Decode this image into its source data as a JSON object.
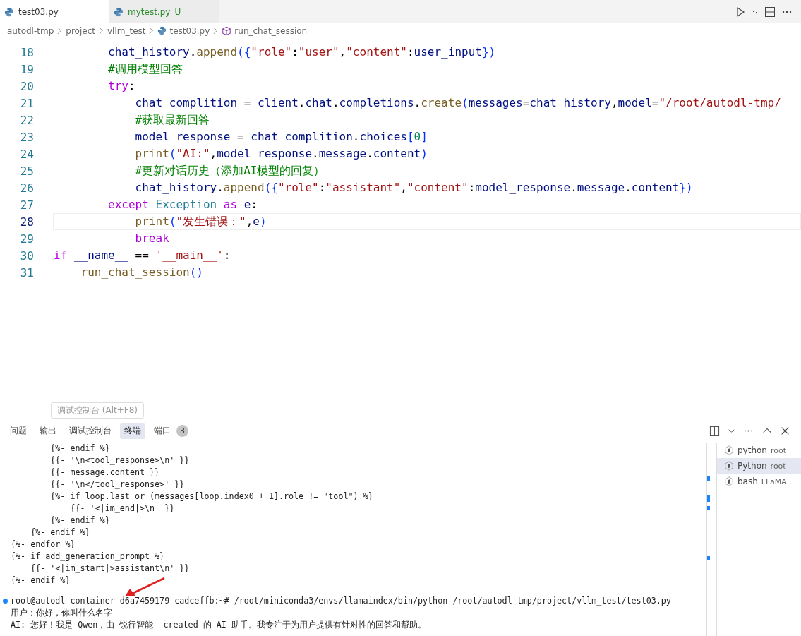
{
  "tabs": [
    {
      "label": "test03.py",
      "selected": true
    },
    {
      "label": "mytest.py",
      "selected": false,
      "status": "U"
    }
  ],
  "breadcrumb": [
    {
      "label": "autodl-tmp",
      "kind": "folder"
    },
    {
      "label": "project",
      "kind": "folder"
    },
    {
      "label": "vllm_test",
      "kind": "folder"
    },
    {
      "label": "test03.py",
      "kind": "file"
    },
    {
      "label": "run_chat_session",
      "kind": "symbol"
    }
  ],
  "editor": {
    "lines": [
      {
        "number": "18",
        "selected": false,
        "tokens": [
          {
            "kind": "variable",
            "text": "        chat_history"
          },
          {
            "kind": "plain",
            "text": "."
          },
          {
            "kind": "function",
            "text": "append"
          },
          {
            "kind": "bracket",
            "text": "({"
          },
          {
            "kind": "string",
            "text": "\"role\""
          },
          {
            "kind": "plain",
            "text": ":"
          },
          {
            "kind": "string",
            "text": "\"user\""
          },
          {
            "kind": "plain",
            "text": ","
          },
          {
            "kind": "string",
            "text": "\"content\""
          },
          {
            "kind": "plain",
            "text": ":"
          },
          {
            "kind": "variable",
            "text": "user_input"
          },
          {
            "kind": "bracket",
            "text": "})"
          }
        ]
      },
      {
        "number": "19",
        "selected": false,
        "tokens": [
          {
            "kind": "comment",
            "text": "        #调用模型回答"
          }
        ]
      },
      {
        "number": "20",
        "selected": false,
        "tokens": [
          {
            "kind": "keyword",
            "text": "        try"
          },
          {
            "kind": "plain",
            "text": ":"
          }
        ]
      },
      {
        "number": "21",
        "selected": false,
        "tokens": [
          {
            "kind": "variable",
            "text": "            chat_complition"
          },
          {
            "kind": "plain",
            "text": " = "
          },
          {
            "kind": "variable",
            "text": "client"
          },
          {
            "kind": "plain",
            "text": "."
          },
          {
            "kind": "variable",
            "text": "chat"
          },
          {
            "kind": "plain",
            "text": "."
          },
          {
            "kind": "variable",
            "text": "completions"
          },
          {
            "kind": "plain",
            "text": "."
          },
          {
            "kind": "function",
            "text": "create"
          },
          {
            "kind": "bracket",
            "text": "("
          },
          {
            "kind": "variable",
            "text": "messages"
          },
          {
            "kind": "plain",
            "text": "="
          },
          {
            "kind": "variable",
            "text": "chat_history"
          },
          {
            "kind": "plain",
            "text": ","
          },
          {
            "kind": "variable",
            "text": "model"
          },
          {
            "kind": "plain",
            "text": "="
          },
          {
            "kind": "string",
            "text": "\"/root/autodl-tmp/"
          }
        ]
      },
      {
        "number": "22",
        "selected": false,
        "tokens": [
          {
            "kind": "comment",
            "text": "            #获取最新回答"
          }
        ]
      },
      {
        "number": "23",
        "selected": false,
        "tokens": [
          {
            "kind": "variable",
            "text": "            model_response"
          },
          {
            "kind": "plain",
            "text": " = "
          },
          {
            "kind": "variable",
            "text": "chat_complition"
          },
          {
            "kind": "plain",
            "text": "."
          },
          {
            "kind": "variable",
            "text": "choices"
          },
          {
            "kind": "bracket",
            "text": "["
          },
          {
            "kind": "number",
            "text": "0"
          },
          {
            "kind": "bracket",
            "text": "]"
          }
        ]
      },
      {
        "number": "24",
        "selected": false,
        "tokens": [
          {
            "kind": "function",
            "text": "            print"
          },
          {
            "kind": "bracket",
            "text": "("
          },
          {
            "kind": "string",
            "text": "\"AI:\""
          },
          {
            "kind": "plain",
            "text": ","
          },
          {
            "kind": "variable",
            "text": "model_response"
          },
          {
            "kind": "plain",
            "text": "."
          },
          {
            "kind": "variable",
            "text": "message"
          },
          {
            "kind": "plain",
            "text": "."
          },
          {
            "kind": "variable",
            "text": "content"
          },
          {
            "kind": "bracket",
            "text": ")"
          }
        ]
      },
      {
        "number": "25",
        "selected": false,
        "tokens": [
          {
            "kind": "comment",
            "text": "            #更新对话历史（添加AI模型的回复）"
          }
        ]
      },
      {
        "number": "26",
        "selected": false,
        "tokens": [
          {
            "kind": "variable",
            "text": "            chat_history"
          },
          {
            "kind": "plain",
            "text": "."
          },
          {
            "kind": "function",
            "text": "append"
          },
          {
            "kind": "bracket",
            "text": "({"
          },
          {
            "kind": "string",
            "text": "\"role\""
          },
          {
            "kind": "plain",
            "text": ":"
          },
          {
            "kind": "string",
            "text": "\"assistant\""
          },
          {
            "kind": "plain",
            "text": ","
          },
          {
            "kind": "string",
            "text": "\"content\""
          },
          {
            "kind": "plain",
            "text": ":"
          },
          {
            "kind": "variable",
            "text": "model_response"
          },
          {
            "kind": "plain",
            "text": "."
          },
          {
            "kind": "variable",
            "text": "message"
          },
          {
            "kind": "plain",
            "text": "."
          },
          {
            "kind": "variable",
            "text": "content"
          },
          {
            "kind": "bracket",
            "text": "})"
          }
        ]
      },
      {
        "number": "27",
        "selected": false,
        "tokens": [
          {
            "kind": "keyword",
            "text": "        except"
          },
          {
            "kind": "type",
            "text": " Exception"
          },
          {
            "kind": "keyword",
            "text": " as"
          },
          {
            "kind": "variable",
            "text": " e"
          },
          {
            "kind": "plain",
            "text": ":"
          }
        ]
      },
      {
        "number": "28",
        "selected": true,
        "tokens": [
          {
            "kind": "function",
            "text": "            print"
          },
          {
            "kind": "bracket",
            "text": "("
          },
          {
            "kind": "string",
            "text": "\"发生错误：\""
          },
          {
            "kind": "plain",
            "text": ","
          },
          {
            "kind": "variable",
            "text": "e"
          },
          {
            "kind": "bracket",
            "text": ")"
          }
        ]
      },
      {
        "number": "29",
        "selected": false,
        "tokens": [
          {
            "kind": "keyword",
            "text": "            break"
          }
        ]
      },
      {
        "number": "30",
        "selected": false,
        "tokens": [
          {
            "kind": "keyword",
            "text": "if"
          },
          {
            "kind": "variable",
            "text": " __name__"
          },
          {
            "kind": "plain",
            "text": " == "
          },
          {
            "kind": "string",
            "text": "'__main__'"
          },
          {
            "kind": "plain",
            "text": ":"
          }
        ]
      },
      {
        "number": "31",
        "selected": false,
        "tokens": [
          {
            "kind": "function",
            "text": "    run_chat_session"
          },
          {
            "kind": "bracket",
            "text": "()"
          }
        ]
      }
    ]
  },
  "panel": {
    "tooltip": "调试控制台 (Alt+F8)",
    "tabs": [
      {
        "label": "问题",
        "selected": false
      },
      {
        "label": "输出",
        "selected": false
      },
      {
        "label": "调试控制台",
        "selected": false
      },
      {
        "label": "终端",
        "selected": true
      },
      {
        "label": "端口",
        "selected": false,
        "badge": "3"
      }
    ],
    "terminal_lines": [
      "        {%- endif %}",
      "        {{- '\\n<tool_response>\\n' }}",
      "        {{- message.content }}",
      "        {{- '\\n</tool_response>' }}",
      "        {%- if loop.last or (messages[loop.index0 + 1].role != \"tool\") %}",
      "            {{- '<|im_end|>\\n' }}",
      "        {%- endif %}",
      "    {%- endif %}",
      "{%- endfor %}",
      "{%- if add_generation_prompt %}",
      "    {{- '<|im_start|>assistant\\n' }}",
      "{%- endif %}"
    ],
    "prompt": "root@autodl-container-d6a7459179-cadceffb:~# /root/miniconda3/envs/llamaindex/bin/python /root/autodl-tmp/project/vllm_test/test03.py",
    "output_lines": [
      "用户：你好，你叫什么名字",
      "AI: 您好！我是 Qwen，由 锐行智能  created 的 AI 助手。我专注于为用户提供有针对性的回答和帮助。"
    ],
    "terminals": [
      {
        "name": "python",
        "detail": "root",
        "selected": false
      },
      {
        "name": "Python",
        "detail": "root",
        "selected": true
      },
      {
        "name": "bash",
        "detail": "LLaMA...",
        "selected": false
      }
    ]
  }
}
